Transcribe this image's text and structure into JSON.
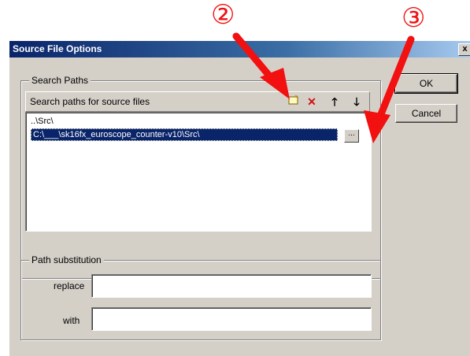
{
  "dialog": {
    "title": "Source File Options",
    "close_glyph": "x"
  },
  "search_paths": {
    "group_label": "Search Paths",
    "header_label": "Search paths for source files",
    "toolbar_icons": [
      "new-folder-icon",
      "delete-icon",
      "move-up-icon",
      "move-down-icon"
    ],
    "items": [
      {
        "label": "..\\Src\\",
        "selected": false
      },
      {
        "label": "C:\\___\\sk16fx_euroscope_counter-v10\\Src\\",
        "selected": true
      }
    ],
    "browse_label": "..."
  },
  "buttons": {
    "ok_label": "OK",
    "cancel_label": "Cancel"
  },
  "path_substitution": {
    "group_label": "Path substitution",
    "replace_label": "replace",
    "replace_value": "",
    "with_label": "with",
    "with_value": ""
  },
  "callouts": {
    "two": "②",
    "three": "③"
  },
  "colors": {
    "arrow": "#f21010",
    "title_bar": "#0a246a",
    "selection": "#0a246a"
  }
}
